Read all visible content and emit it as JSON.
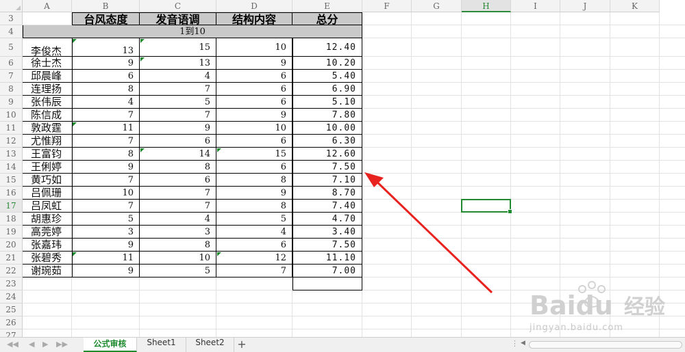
{
  "columns": [
    "A",
    "B",
    "C",
    "D",
    "E",
    "F",
    "G",
    "H",
    "I",
    "J",
    "K"
  ],
  "selected_column": "H",
  "selected_row": "17",
  "row_numbers": [
    "3",
    "4",
    "5",
    "6",
    "7",
    "8",
    "9",
    "10",
    "11",
    "12",
    "13",
    "14",
    "15",
    "16",
    "17",
    "18",
    "19",
    "20",
    "21",
    "22",
    "23",
    "24",
    "25",
    "26",
    "27"
  ],
  "table": {
    "headers": [
      "台风态度",
      "发音语调",
      "结构内容",
      "总分"
    ],
    "merged_label": "1到10",
    "rows": [
      {
        "name": "李俊杰",
        "b": "13",
        "c": "15",
        "d": "10",
        "e": "12.40"
      },
      {
        "name": "徐士杰",
        "b": "9",
        "c": "13",
        "d": "9",
        "e": "10.20"
      },
      {
        "name": "邱晨峰",
        "b": "6",
        "c": "4",
        "d": "6",
        "e": "5.40"
      },
      {
        "name": "连理扬",
        "b": "8",
        "c": "7",
        "d": "6",
        "e": "6.90"
      },
      {
        "name": "张伟辰",
        "b": "4",
        "c": "5",
        "d": "6",
        "e": "5.10"
      },
      {
        "name": "陈信成",
        "b": "7",
        "c": "7",
        "d": "9",
        "e": "7.80"
      },
      {
        "name": "敦政霆",
        "b": "11",
        "c": "9",
        "d": "10",
        "e": "10.00"
      },
      {
        "name": "尤惟翔",
        "b": "7",
        "c": "6",
        "d": "6",
        "e": "6.30"
      },
      {
        "name": "王富钧",
        "b": "8",
        "c": "14",
        "d": "15",
        "e": "12.60"
      },
      {
        "name": "王俐婷",
        "b": "9",
        "c": "8",
        "d": "6",
        "e": "7.50"
      },
      {
        "name": "黄巧如",
        "b": "7",
        "c": "6",
        "d": "8",
        "e": "7.10"
      },
      {
        "name": "吕佩珊",
        "b": "10",
        "c": "7",
        "d": "9",
        "e": "8.70"
      },
      {
        "name": "吕凤虹",
        "b": "7",
        "c": "7",
        "d": "8",
        "e": "7.40"
      },
      {
        "name": "胡惠珍",
        "b": "5",
        "c": "4",
        "d": "5",
        "e": "4.70"
      },
      {
        "name": "高莞婷",
        "b": "3",
        "c": "3",
        "d": "4",
        "e": "3.40"
      },
      {
        "name": "张嘉玮",
        "b": "9",
        "c": "8",
        "d": "6",
        "e": "7.50"
      },
      {
        "name": "张碧秀",
        "b": "11",
        "c": "10",
        "d": "12",
        "e": "11.10"
      },
      {
        "name": "谢琬茹",
        "b": "9",
        "c": "5",
        "d": "7",
        "e": "7.00"
      }
    ]
  },
  "sheet_tabs": [
    {
      "label": "公式审核",
      "active": true
    },
    {
      "label": "Sheet1",
      "active": false
    },
    {
      "label": "Sheet2",
      "active": false
    }
  ],
  "add_sheet": "+",
  "watermark": {
    "brand": "Baidu",
    "brand_cn": "经验",
    "url": "jingyan.baidu.com"
  },
  "colors": {
    "accent": "#1f8a2e",
    "arrow": "#e8231f",
    "header_fill": "#c9c9c9"
  }
}
